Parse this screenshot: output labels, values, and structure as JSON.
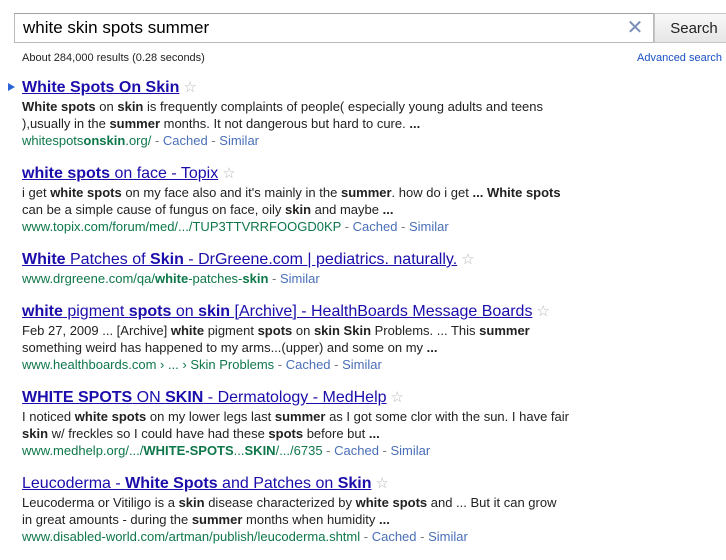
{
  "search": {
    "query": "white skin spots summer",
    "button_label": "Search",
    "clear_glyph": "✕",
    "stats": "About 284,000 results (0.28 seconds)",
    "advanced_link": "Advanced search"
  },
  "results": [
    {
      "title_parts": [
        [
          "White Spots",
          "b"
        ],
        [
          " "
        ],
        [
          "On Skin",
          "b"
        ]
      ],
      "snippet_parts": [
        [
          "White spots",
          "b"
        ],
        [
          " on "
        ],
        [
          "skin",
          "b"
        ],
        [
          " is frequently complaints of people( especially young adults and teens ),usually in the "
        ],
        [
          "summer",
          "b"
        ],
        [
          " months. It not dangerous but hard to cure. "
        ],
        [
          "...",
          "b"
        ]
      ],
      "url_parts": [
        [
          "whitespots"
        ],
        [
          "onskin",
          "b"
        ],
        [
          ".org/"
        ]
      ],
      "cached": "Cached",
      "similar": "Similar"
    },
    {
      "title_parts": [
        [
          "white spots",
          "b"
        ],
        [
          " on face - Topix"
        ]
      ],
      "snippet_parts": [
        [
          "i get "
        ],
        [
          "white spots",
          "b"
        ],
        [
          " on my face also and it's mainly in the "
        ],
        [
          "summer",
          "b"
        ],
        [
          ". how do i get "
        ],
        [
          "... White spots",
          "b"
        ],
        [
          " can be a simple cause of fungus on face, oily "
        ],
        [
          "skin",
          "b"
        ],
        [
          " and maybe "
        ],
        [
          "...",
          "b"
        ]
      ],
      "url_parts": [
        [
          "www.topix.com/forum/med/.../TUP3TTVRRFOOGD0KP"
        ]
      ],
      "cached": "Cached",
      "similar": "Similar"
    },
    {
      "title_parts": [
        [
          "White",
          "b"
        ],
        [
          " Patches of "
        ],
        [
          "Skin",
          "b"
        ],
        [
          " - DrGreene.com | pediatrics. naturally."
        ]
      ],
      "snippet_parts": [],
      "url_parts": [
        [
          "www.drgreene.com/qa/"
        ],
        [
          "white",
          "b"
        ],
        [
          "-patches-"
        ],
        [
          "skin",
          "b"
        ]
      ],
      "cached": "",
      "similar": "Similar"
    },
    {
      "title_parts": [
        [
          "white",
          "b"
        ],
        [
          " pigment "
        ],
        [
          "spots",
          "b"
        ],
        [
          " on "
        ],
        [
          "skin",
          "b"
        ],
        [
          " [Archive] - HealthBoards Message Boards"
        ]
      ],
      "snippet_parts": [
        [
          "Feb 27, 2009 ... [Archive] "
        ],
        [
          "white",
          "b"
        ],
        [
          " pigment "
        ],
        [
          "spots",
          "b"
        ],
        [
          " on "
        ],
        [
          "skin Skin",
          "b"
        ],
        [
          " Problems. ... This "
        ],
        [
          "summer",
          "b"
        ],
        [
          " something weird has happened to my arms...(upper) and some on my "
        ],
        [
          "...",
          "b"
        ]
      ],
      "url_parts": [
        [
          "www.healthboards.com › ... › Skin Problems"
        ]
      ],
      "cached": "Cached",
      "similar": "Similar"
    },
    {
      "title_parts": [
        [
          "WHITE SPOTS",
          "b"
        ],
        [
          " ON "
        ],
        [
          "SKIN",
          "b"
        ],
        [
          " - Dermatology - MedHelp"
        ]
      ],
      "snippet_parts": [
        [
          "I noticed "
        ],
        [
          "white spots",
          "b"
        ],
        [
          " on my lower legs last "
        ],
        [
          "summer",
          "b"
        ],
        [
          " as I got some clor with the sun. I have fair "
        ],
        [
          "skin",
          "b"
        ],
        [
          " w/ freckles so I could have had these "
        ],
        [
          "spots",
          "b"
        ],
        [
          " before but "
        ],
        [
          "...",
          "b"
        ]
      ],
      "url_parts": [
        [
          "www.medhelp.org/.../"
        ],
        [
          "WHITE-SPOTS",
          "b"
        ],
        [
          "..."
        ],
        [
          "SKIN",
          "b"
        ],
        [
          "/.../6735"
        ]
      ],
      "cached": "Cached",
      "similar": "Similar"
    },
    {
      "title_parts": [
        [
          "Leucoderma - "
        ],
        [
          "White Spots",
          "b"
        ],
        [
          " and Patches on "
        ],
        [
          "Skin",
          "b"
        ]
      ],
      "snippet_parts": [
        [
          "Leucoderma or Vitiligo is a "
        ],
        [
          "skin",
          "b"
        ],
        [
          " disease characterized by "
        ],
        [
          "white spots",
          "b"
        ],
        [
          " and ... But it can grow in great amounts - during the "
        ],
        [
          "summer",
          "b"
        ],
        [
          " months when humidity "
        ],
        [
          "...",
          "b"
        ]
      ],
      "url_parts": [
        [
          "www.disabled-world.com/artman/publish/leucoderma.shtml"
        ]
      ],
      "cached": "Cached",
      "similar": "Similar"
    }
  ]
}
